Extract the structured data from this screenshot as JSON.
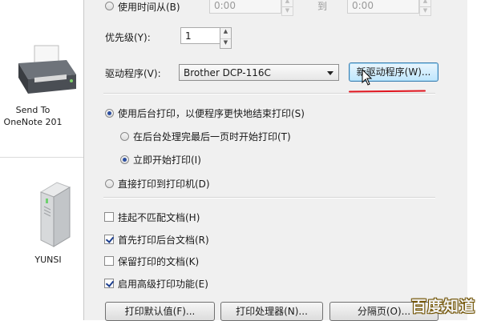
{
  "desktop": {
    "icons": [
      {
        "label": "Send To\nOneNote 201",
        "icon": "printer-icon"
      },
      {
        "label": "YUNSI",
        "icon": "drive-icon"
      }
    ]
  },
  "dialog": {
    "time_radio_label": "使用时间从(B)",
    "time_from": "0:00",
    "time_to_label": "到",
    "time_to": "0:00",
    "priority_label": "优先级(Y):",
    "priority_value": "1",
    "driver_label": "驱动程序(V):",
    "driver_value": "Brother DCP-116C",
    "new_driver_button": "新驱动程序(W)...",
    "spool_radio_label": "使用后台打印，以便程序更快地结束打印(S)",
    "spool_after_last_label": "在后台处理完最后一页时开始打印(T)",
    "spool_immediate_label": "立即开始打印(I)",
    "direct_print_label": "直接打印到打印机(D)",
    "checkboxes": [
      {
        "label": "挂起不匹配文档(H)",
        "checked": false
      },
      {
        "label": "首先打印后台文档(R)",
        "checked": true
      },
      {
        "label": "保留打印的文档(K)",
        "checked": false
      },
      {
        "label": "启用高级打印功能(E)",
        "checked": true
      }
    ],
    "bottom_buttons": {
      "defaults": "打印默认值(F)...",
      "processor": "打印处理器(N)...",
      "separator": "分隔页(O)..."
    }
  },
  "annotation_color": "#e0141e",
  "watermark": "百度知道"
}
